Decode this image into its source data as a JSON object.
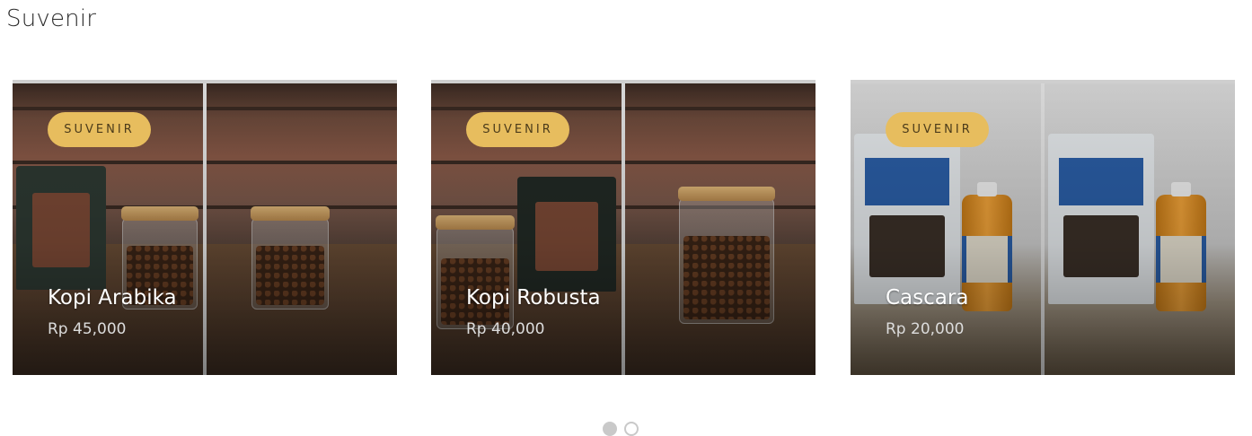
{
  "section": {
    "title": "Suvenir"
  },
  "products": [
    {
      "badge": "SUVENIR",
      "name": "Kopi Arabika",
      "price": "Rp 45,000"
    },
    {
      "badge": "SUVENIR",
      "name": "Kopi Robusta",
      "price": "Rp 40,000"
    },
    {
      "badge": "SUVENIR",
      "name": "Cascara",
      "price": "Rp 20,000"
    }
  ],
  "carousel": {
    "pages": 2,
    "active_page": 1
  },
  "colors": {
    "badge_bg": "#e7bd5e",
    "title_text": "#ffffff",
    "price_text": "#dcdcdc"
  }
}
